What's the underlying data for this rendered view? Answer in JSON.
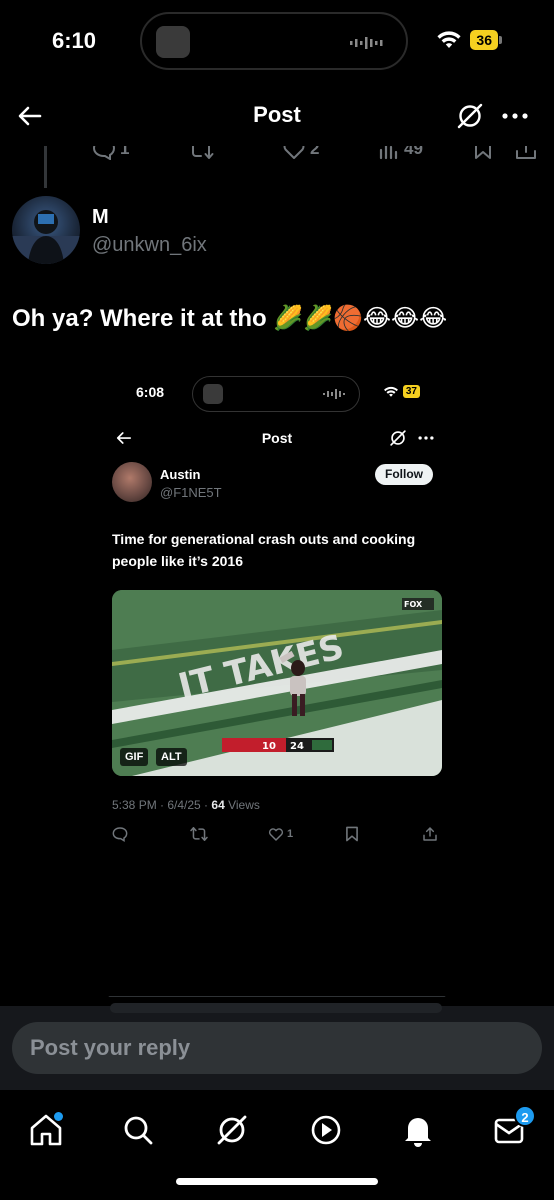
{
  "status_bar": {
    "time": "6:10",
    "battery": "36"
  },
  "header": {
    "title": "Post"
  },
  "prev_post_actions": {
    "replies": "1",
    "likes": "2",
    "views": "49"
  },
  "reply_post": {
    "name": "M",
    "handle": "@unkwn_6ix",
    "text": "Oh ya? Where it at tho 🌽🌽🏀😂😂😂"
  },
  "embedded_screenshot": {
    "status_time": "6:08",
    "battery": "37",
    "title": "Post",
    "author_name": "Austin",
    "author_handle": "@F1NE5T",
    "follow_label": "Follow",
    "text": "Time for generational crash outs and cooking people like it’s 2016",
    "media_badges": [
      "GIF",
      "ALT"
    ],
    "scorebug": {
      "left": "10",
      "right": "24"
    },
    "end_zone_text": "IT TAKES",
    "network": "FOX",
    "meta_time_date": "5:38 PM · 6/4/25 · ",
    "meta_views_count": "64",
    "meta_views_label": " Views",
    "likes": "1"
  },
  "composer": {
    "placeholder": "Post your reply"
  },
  "bottom_nav": {
    "items": [
      "home-icon",
      "search-icon",
      "grok-icon",
      "video-icon",
      "notifications-icon",
      "messages-icon"
    ],
    "messages_badge": "2"
  },
  "colors": {
    "accent": "#1d9bf0",
    "muted": "#71767b",
    "battery": "#f5d020"
  }
}
